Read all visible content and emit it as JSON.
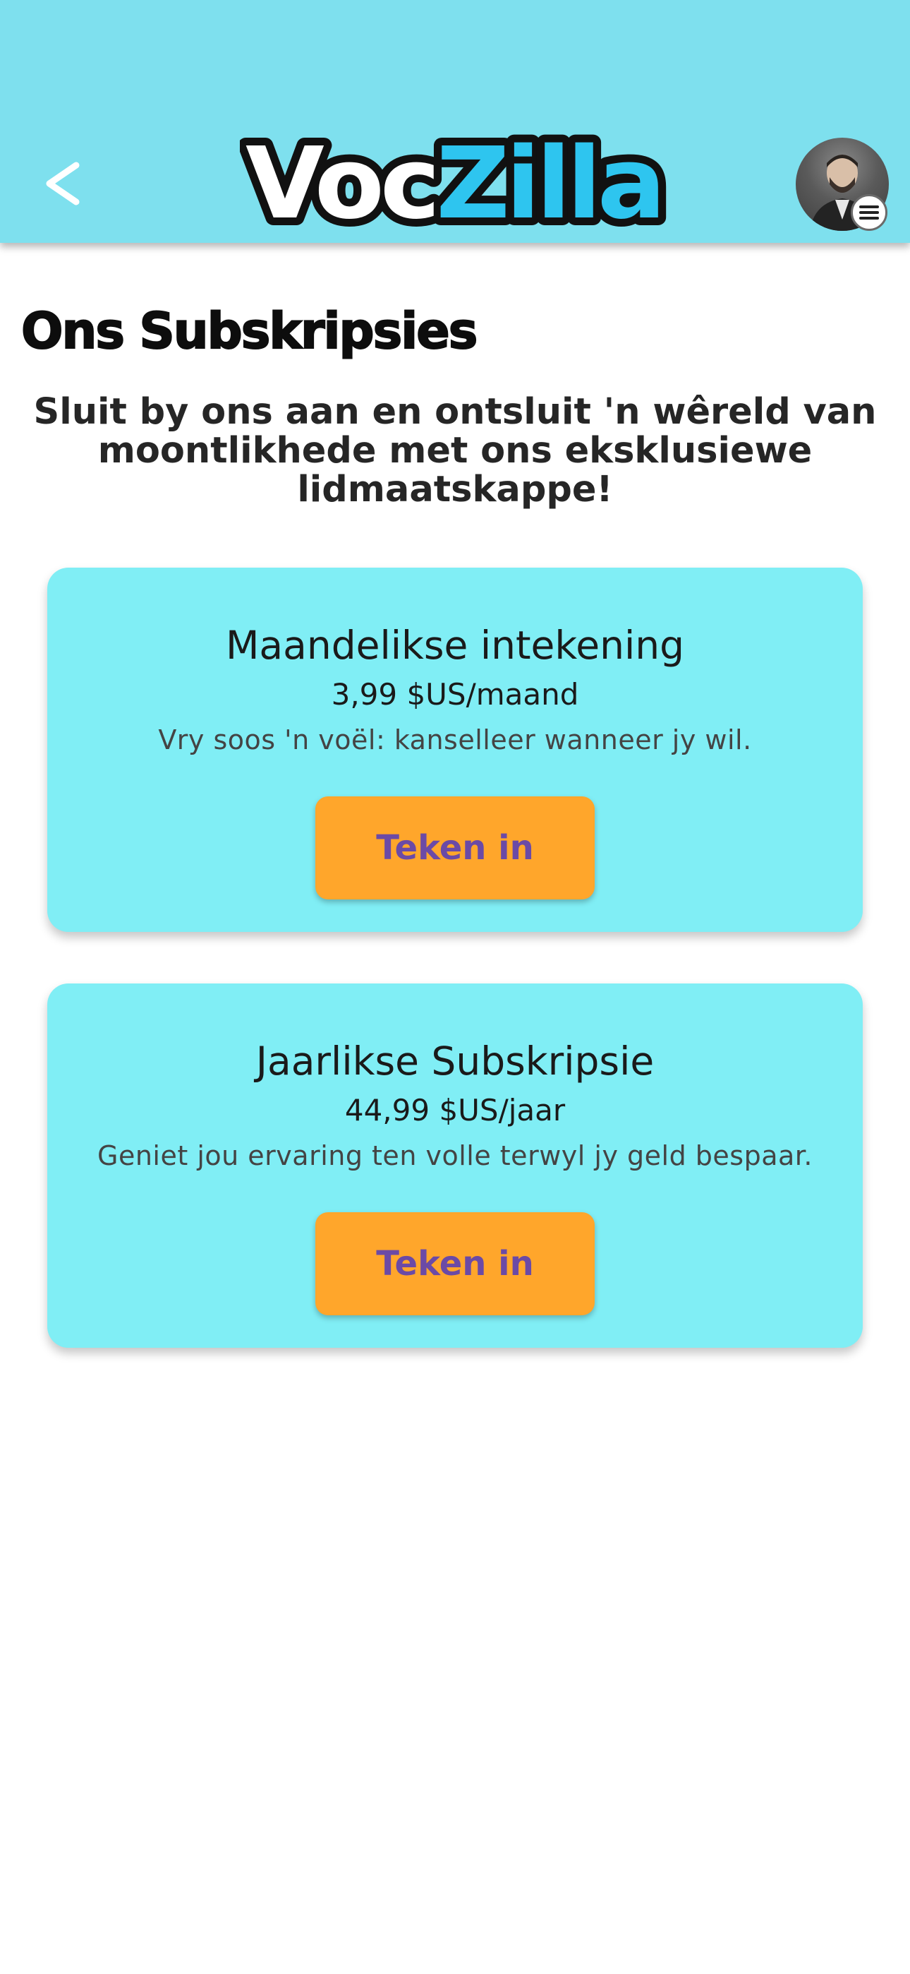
{
  "header": {
    "logo_part1": "Voc",
    "logo_part2": "Zilla",
    "background_color": "#7ee0ee",
    "back_icon": "chevron-left-icon",
    "menu_icon": "hamburger-menu-icon"
  },
  "page": {
    "title": "Ons Subskripsies",
    "intro": "Sluit by ons aan en ontsluit 'n wêreld van moontlikhede met ons eksklusiewe lidmaatskappe!"
  },
  "plans": [
    {
      "title": "Maandelikse intekening",
      "price": "3,99 $US/maand",
      "description": "Vry soos 'n voël: kanselleer wanneer jy wil.",
      "button_label": "Teken in"
    },
    {
      "title": "Jaarlikse Subskripsie",
      "price": "44,99 $US/jaar",
      "description": "Geniet jou ervaring ten volle terwyl jy geld bespaar.",
      "button_label": "Teken in"
    }
  ],
  "colors": {
    "card": "#80eef5",
    "button": "#ffa62b",
    "button_text": "#6b4aa6",
    "logo_accent": "#2ec5ef"
  }
}
